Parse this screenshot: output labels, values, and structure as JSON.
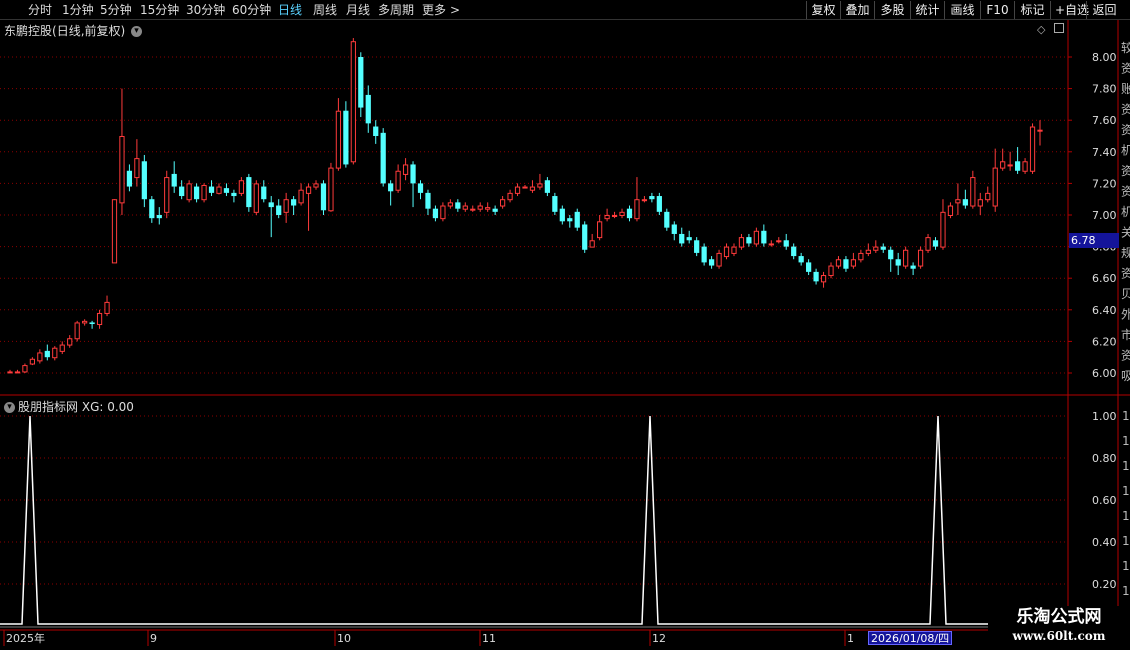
{
  "toolbar": {
    "periods": [
      "分时",
      "1分钟",
      "5分钟",
      "15分钟",
      "30分钟",
      "60分钟",
      "日线",
      "周线",
      "月线",
      "多周期",
      "更多"
    ],
    "active_period": "日线",
    "more_arrow": ">",
    "right_buttons": [
      "复权",
      "叠加",
      "多股",
      "统计",
      "画线",
      "F10",
      "标记",
      "+自选",
      "返回"
    ]
  },
  "header": {
    "stock_name": "东鹏控股",
    "mode": "(日线,前复权)",
    "collapse_icon": "chevron-down-icon"
  },
  "indicator": {
    "name": "股朋指标网",
    "label": "XG: 0.00"
  },
  "price_tag": "6.78",
  "date_tag": "2026/01/08/四",
  "watermark": {
    "title": "乐淘公式网",
    "url": "www.60lt.com"
  },
  "colors": {
    "up": "#ff3b3b",
    "down": "#54ffff",
    "grid": "#8b0000",
    "axis": "#b40000",
    "line": "#ffffff"
  },
  "chart_data": [
    {
      "type": "candlestick",
      "title": "东鹏控股(日线,前复权)",
      "ylim": [
        5.85,
        8.25
      ],
      "yticks": [
        6.0,
        6.2,
        6.4,
        6.6,
        6.8,
        7.0,
        7.2,
        7.4,
        7.6,
        7.8,
        8.0
      ],
      "xticks": [
        "2025年",
        "9",
        "10",
        "11",
        "12",
        "1"
      ],
      "right_clipped_labels": [
        "较",
        "资",
        "账",
        "资",
        "资",
        "机",
        "资",
        "资",
        "机",
        "关",
        "规",
        "资",
        "贝",
        "外",
        "市",
        "资",
        "吸"
      ],
      "candles": [
        [
          6.01,
          6.01,
          6.02,
          6.0
        ],
        [
          6.01,
          6.01,
          6.02,
          6.0
        ],
        [
          6.01,
          6.05,
          6.06,
          6.0
        ],
        [
          6.06,
          6.09,
          6.1,
          6.05
        ],
        [
          6.08,
          6.13,
          6.15,
          6.06
        ],
        [
          6.14,
          6.1,
          6.18,
          6.08
        ],
        [
          6.1,
          6.16,
          6.17,
          6.08
        ],
        [
          6.14,
          6.18,
          6.2,
          6.12
        ],
        [
          6.18,
          6.22,
          6.24,
          6.16
        ],
        [
          6.22,
          6.32,
          6.33,
          6.2
        ],
        [
          6.32,
          6.33,
          6.34,
          6.3
        ],
        [
          6.32,
          6.31,
          6.33,
          6.28
        ],
        [
          6.31,
          6.38,
          6.4,
          6.28
        ],
        [
          6.38,
          6.45,
          6.49,
          6.36
        ],
        [
          6.7,
          7.1,
          7.1,
          6.7
        ],
        [
          7.08,
          7.5,
          7.8,
          7.0
        ],
        [
          7.28,
          7.18,
          7.32,
          7.15
        ],
        [
          7.24,
          7.36,
          7.48,
          7.18
        ],
        [
          7.34,
          7.1,
          7.38,
          7.05
        ],
        [
          7.1,
          6.98,
          7.12,
          6.95
        ],
        [
          7.0,
          6.98,
          7.05,
          6.94
        ],
        [
          7.02,
          7.24,
          7.28,
          6.98
        ],
        [
          7.26,
          7.18,
          7.34,
          7.14
        ],
        [
          7.18,
          7.12,
          7.22,
          7.1
        ],
        [
          7.1,
          7.2,
          7.22,
          7.08
        ],
        [
          7.18,
          7.1,
          7.2,
          7.08
        ],
        [
          7.1,
          7.19,
          7.2,
          7.08
        ],
        [
          7.18,
          7.14,
          7.22,
          7.12
        ],
        [
          7.14,
          7.18,
          7.2,
          7.13
        ],
        [
          7.17,
          7.14,
          7.2,
          7.12
        ],
        [
          7.14,
          7.12,
          7.16,
          7.08
        ],
        [
          7.14,
          7.22,
          7.24,
          7.12
        ],
        [
          7.24,
          7.05,
          7.26,
          7.02
        ],
        [
          7.02,
          7.2,
          7.22,
          7.0
        ],
        [
          7.18,
          7.1,
          7.22,
          7.08
        ],
        [
          7.08,
          7.05,
          7.12,
          6.86
        ],
        [
          7.06,
          7.0,
          7.1,
          6.98
        ],
        [
          7.02,
          7.1,
          7.14,
          6.95
        ],
        [
          7.1,
          7.06,
          7.12,
          7.0
        ],
        [
          7.08,
          7.16,
          7.2,
          7.06
        ],
        [
          7.14,
          7.18,
          7.2,
          6.9
        ],
        [
          7.18,
          7.2,
          7.22,
          7.16
        ],
        [
          7.2,
          7.03,
          7.22,
          7.0
        ],
        [
          7.03,
          7.3,
          7.33,
          7.02
        ],
        [
          7.3,
          7.66,
          7.74,
          7.28
        ],
        [
          7.66,
          7.32,
          7.72,
          7.3
        ],
        [
          7.34,
          8.1,
          8.12,
          7.32
        ],
        [
          8.0,
          7.68,
          8.03,
          7.62
        ],
        [
          7.76,
          7.58,
          7.82,
          7.52
        ],
        [
          7.56,
          7.5,
          7.6,
          7.45
        ],
        [
          7.52,
          7.2,
          7.55,
          7.18
        ],
        [
          7.2,
          7.15,
          7.22,
          7.06
        ],
        [
          7.16,
          7.28,
          7.32,
          7.14
        ],
        [
          7.26,
          7.32,
          7.36,
          7.22
        ],
        [
          7.32,
          7.2,
          7.34,
          7.05
        ],
        [
          7.2,
          7.14,
          7.22,
          7.1
        ],
        [
          7.14,
          7.04,
          7.16,
          7.0
        ],
        [
          7.04,
          6.98,
          7.06,
          6.96
        ],
        [
          6.98,
          7.06,
          7.08,
          6.96
        ],
        [
          7.06,
          7.08,
          7.1,
          7.04
        ],
        [
          7.08,
          7.04,
          7.1,
          7.02
        ],
        [
          7.04,
          7.06,
          7.08,
          7.02
        ],
        [
          7.04,
          7.04,
          7.06,
          7.02
        ],
        [
          7.04,
          7.06,
          7.08,
          7.02
        ],
        [
          7.04,
          7.05,
          7.08,
          7.02
        ],
        [
          7.04,
          7.02,
          7.06,
          7.0
        ],
        [
          7.06,
          7.1,
          7.12,
          7.04
        ],
        [
          7.1,
          7.14,
          7.16,
          7.08
        ],
        [
          7.14,
          7.18,
          7.2,
          7.12
        ],
        [
          7.18,
          7.18,
          7.19,
          7.17
        ],
        [
          7.16,
          7.18,
          7.22,
          7.14
        ],
        [
          7.18,
          7.2,
          7.26,
          7.16
        ],
        [
          7.22,
          7.14,
          7.24,
          7.12
        ],
        [
          7.12,
          7.02,
          7.14,
          7.0
        ],
        [
          7.04,
          6.96,
          7.06,
          6.94
        ],
        [
          6.98,
          6.96,
          7.0,
          6.92
        ],
        [
          7.02,
          6.92,
          7.04,
          6.9
        ],
        [
          6.94,
          6.78,
          6.96,
          6.76
        ],
        [
          6.8,
          6.84,
          6.88,
          6.8
        ],
        [
          6.86,
          6.96,
          7.0,
          6.84
        ],
        [
          6.98,
          7.0,
          7.04,
          6.96
        ],
        [
          7.0,
          7.0,
          7.02,
          6.98
        ],
        [
          7.0,
          7.02,
          7.04,
          6.98
        ],
        [
          7.04,
          6.98,
          7.06,
          6.96
        ],
        [
          6.98,
          7.1,
          7.24,
          6.96
        ],
        [
          7.1,
          7.1,
          7.12,
          7.08
        ],
        [
          7.12,
          7.1,
          7.14,
          7.08
        ],
        [
          7.12,
          7.02,
          7.14,
          7.0
        ],
        [
          7.02,
          6.92,
          7.04,
          6.9
        ],
        [
          6.94,
          6.88,
          6.96,
          6.84
        ],
        [
          6.88,
          6.82,
          6.92,
          6.8
        ],
        [
          6.86,
          6.84,
          6.9,
          6.82
        ],
        [
          6.84,
          6.76,
          6.86,
          6.74
        ],
        [
          6.8,
          6.7,
          6.82,
          6.68
        ],
        [
          6.72,
          6.68,
          6.74,
          6.66
        ],
        [
          6.68,
          6.76,
          6.78,
          6.66
        ],
        [
          6.74,
          6.8,
          6.82,
          6.72
        ],
        [
          6.76,
          6.8,
          6.82,
          6.74
        ],
        [
          6.8,
          6.86,
          6.88,
          6.78
        ],
        [
          6.86,
          6.82,
          6.88,
          6.8
        ],
        [
          6.82,
          6.9,
          6.92,
          6.8
        ],
        [
          6.9,
          6.82,
          6.94,
          6.8
        ],
        [
          6.82,
          6.82,
          6.84,
          6.8
        ],
        [
          6.84,
          6.84,
          6.86,
          6.82
        ],
        [
          6.84,
          6.8,
          6.88,
          6.78
        ],
        [
          6.8,
          6.74,
          6.82,
          6.72
        ],
        [
          6.74,
          6.7,
          6.76,
          6.68
        ],
        [
          6.7,
          6.64,
          6.72,
          6.62
        ],
        [
          6.64,
          6.58,
          6.66,
          6.56
        ],
        [
          6.58,
          6.62,
          6.64,
          6.54
        ],
        [
          6.62,
          6.68,
          6.7,
          6.6
        ],
        [
          6.68,
          6.72,
          6.74,
          6.66
        ],
        [
          6.72,
          6.66,
          6.74,
          6.64
        ],
        [
          6.68,
          6.72,
          6.76,
          6.66
        ],
        [
          6.72,
          6.76,
          6.78,
          6.7
        ],
        [
          6.76,
          6.78,
          6.82,
          6.74
        ],
        [
          6.78,
          6.8,
          6.84,
          6.76
        ],
        [
          6.8,
          6.78,
          6.82,
          6.76
        ],
        [
          6.78,
          6.72,
          6.8,
          6.64
        ],
        [
          6.72,
          6.68,
          6.76,
          6.62
        ],
        [
          6.68,
          6.78,
          6.8,
          6.66
        ],
        [
          6.68,
          6.66,
          6.7,
          6.62
        ],
        [
          6.68,
          6.78,
          6.8,
          6.66
        ],
        [
          6.78,
          6.86,
          6.88,
          6.76
        ],
        [
          6.84,
          6.8,
          6.86,
          6.78
        ],
        [
          6.8,
          7.02,
          7.1,
          6.78
        ],
        [
          7.0,
          7.06,
          7.08,
          6.98
        ],
        [
          7.08,
          7.1,
          7.2,
          7.0
        ],
        [
          7.1,
          7.06,
          7.16,
          7.04
        ],
        [
          7.06,
          7.24,
          7.28,
          7.04
        ],
        [
          7.06,
          7.1,
          7.14,
          7.0
        ],
        [
          7.1,
          7.14,
          7.18,
          7.08
        ],
        [
          7.06,
          7.3,
          7.42,
          7.02
        ],
        [
          7.3,
          7.34,
          7.42,
          7.28
        ],
        [
          7.32,
          7.32,
          7.4,
          7.28
        ],
        [
          7.34,
          7.28,
          7.43,
          7.26
        ],
        [
          7.28,
          7.34,
          7.36,
          7.26
        ],
        [
          7.28,
          7.56,
          7.58,
          7.26
        ],
        [
          7.54,
          7.54,
          7.6,
          7.44
        ]
      ]
    },
    {
      "type": "line",
      "title": "股朋指标网 XG: 0.00",
      "ylim": [
        0,
        1.06
      ],
      "yticks": [
        0.2,
        0.4,
        0.6,
        0.8,
        1.0
      ],
      "series": [
        {
          "name": "XG",
          "spikes_at_index": [
            2,
            80,
            116
          ]
        }
      ]
    }
  ]
}
